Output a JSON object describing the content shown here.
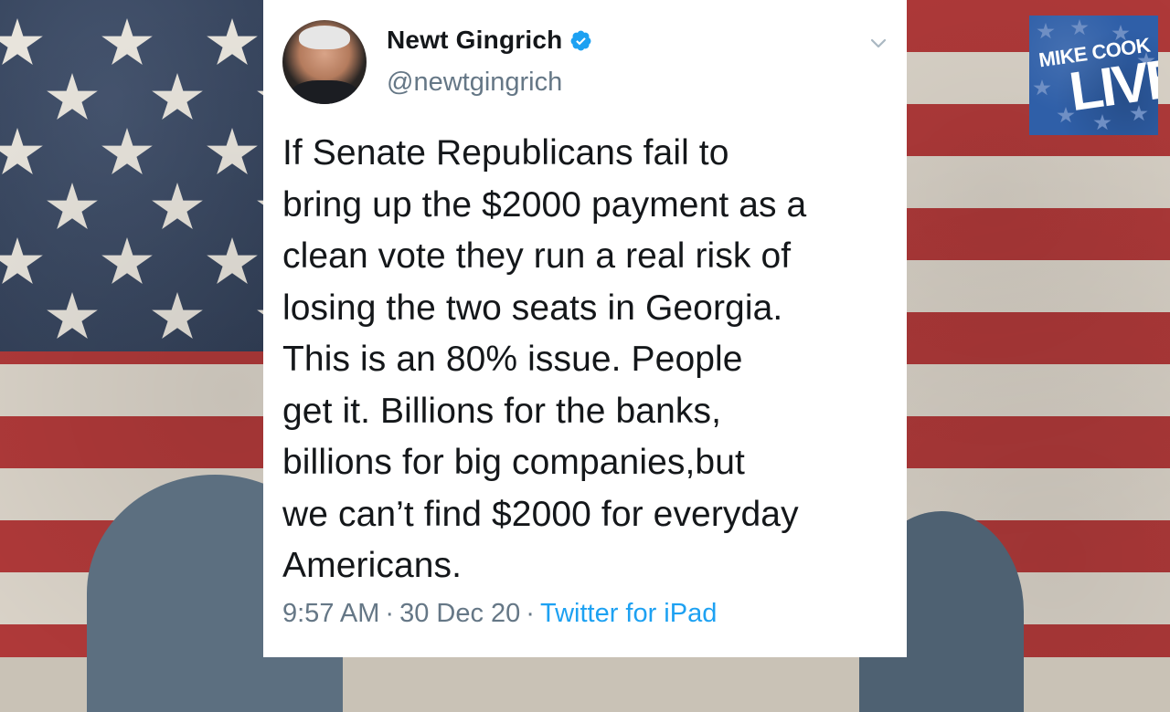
{
  "tweet": {
    "author_name": "Newt Gingrich",
    "author_handle": "@newtgingrich",
    "verified": true,
    "text": "If Senate Republicans fail to\nbring up the $2000 payment as a\nclean vote they run a real risk of\nlosing the two seats in Georgia.\nThis is an 80% issue. People\nget it. Billions for the banks,\nbillions for big companies,but\nwe can’t find $2000 for everyday\nAmericans.",
    "time": "9:57 AM",
    "separator": "·",
    "date": "30 Dec 20",
    "source": "Twitter for iPad"
  },
  "logo": {
    "line1": "MIKE COOK",
    "line2": "LIVE"
  },
  "colors": {
    "link": "#1da1f2",
    "verified_badge": "#1da1f2",
    "secondary_text": "#657786",
    "flag_red": "#b23a3a",
    "flag_blue": "#3a4a66",
    "logo_blue": "#2f5fa8"
  },
  "icons": {
    "verified": "verified-badge-icon",
    "menu": "chevron-down-icon"
  }
}
